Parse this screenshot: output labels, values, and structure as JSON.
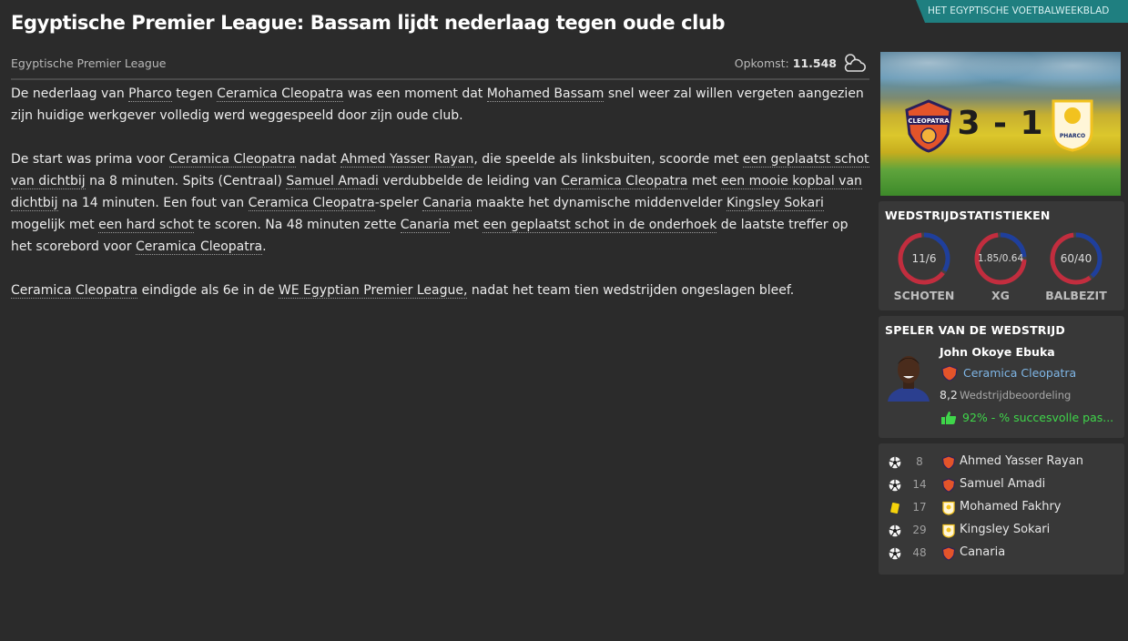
{
  "header": {
    "title": "Egyptische Premier League: Bassam lijdt nederlaag tegen oude club",
    "source_tag": "HET EGYPTISCHE VOETBALWEEKBLAD"
  },
  "meta": {
    "competition": "Egyptische Premier League",
    "attendance_label": "Opkomst:",
    "attendance_value": "11.548",
    "weather_icon": "cloudy-icon"
  },
  "article": {
    "p1": {
      "t0": "De nederlaag van ",
      "l0": "Pharco",
      "t1": " tegen ",
      "l1": "Ceramica Cleopatra",
      "t2": " was een moment dat ",
      "l2": "Mohamed Bassam",
      "t3": " snel weer zal willen vergeten aangezien zijn huidige werkgever volledig werd weggespeeld door zijn oude club."
    },
    "p2": {
      "t0": "De start was prima voor ",
      "l0": "Ceramica Cleopatra",
      "t1": " nadat ",
      "l1": "Ahmed Yasser Rayan",
      "t2": ", die speelde als linksbuiten, scoorde met ",
      "l2": "een geplaatst schot van dichtbij",
      "t3": " na 8 minuten. Spits (Centraal) ",
      "l3": "Samuel Amadi",
      "t4": " verdubbelde de leiding van ",
      "l4": "Ceramica Cleopatra",
      "t5": " met ",
      "l5": "een mooie kopbal van dichtbij",
      "t6": " na 14 minuten. Een fout van ",
      "l6": "Ceramica Cleopatra",
      "t7": "-speler ",
      "l7": "Canaria",
      "t8": " maakte het dynamische middenvelder ",
      "l8": "Kingsley Sokari",
      "t9": " mogelijk met ",
      "l9": "een hard schot",
      "t10": " te scoren. Na 48 minuten zette ",
      "l10": "Canaria",
      "t11": " met ",
      "l11": "een geplaatst schot in de onderhoek",
      "t12": " de laatste treffer op het scorebord voor ",
      "l12": "Ceramica Cleopatra",
      "t13": "."
    },
    "p3": {
      "l0": "Ceramica Cleopatra",
      "t0": " eindigde als 6e in de ",
      "l1": "WE Egyptian Premier League,",
      "t1": " nadat het team tien wedstrijden ongeslagen bleef."
    }
  },
  "match": {
    "score": "3 - 1",
    "home_club": "Ceramica Cleopatra",
    "away_club": "Pharco",
    "home_badge_text": "CLEOPATRA",
    "away_badge_text": "PHARCO",
    "home_color": "#e3542a",
    "away_color": "#f2c21f"
  },
  "stats": {
    "title": "WEDSTRIJDSTATISTIEKEN",
    "items": [
      {
        "label": "SCHOTEN",
        "value": "11/6",
        "home": 11,
        "away": 6
      },
      {
        "label": "XG",
        "value": "1.85/0.64",
        "home": 1.85,
        "away": 0.64
      },
      {
        "label": "BALBEZIT",
        "value": "60/40",
        "home": 60,
        "away": 40
      }
    ],
    "home_color": "#c22d3e",
    "away_color": "#1f3f9c"
  },
  "potm": {
    "title": "SPELER VAN DE WEDSTRIJD",
    "name": "John Okoye Ebuka",
    "club": "Ceramica Cleopatra",
    "rating": "8,2",
    "rating_label": "Wedstrijdbeoordeling",
    "pass_text": "92% - % succesvolle pas..."
  },
  "events": [
    {
      "type": "goal",
      "icon": "ball-icon",
      "minute": "8",
      "team": "home",
      "name": "Ahmed Yasser Rayan"
    },
    {
      "type": "goal",
      "icon": "ball-icon",
      "minute": "14",
      "team": "home",
      "name": "Samuel Amadi"
    },
    {
      "type": "yellow-card",
      "icon": "yellow-card-icon",
      "minute": "17",
      "team": "away",
      "name": "Mohamed Fakhry"
    },
    {
      "type": "goal",
      "icon": "ball-icon",
      "minute": "29",
      "team": "away",
      "name": "Kingsley Sokari"
    },
    {
      "type": "goal",
      "icon": "ball-icon",
      "minute": "48",
      "team": "home",
      "name": "Canaria"
    }
  ]
}
